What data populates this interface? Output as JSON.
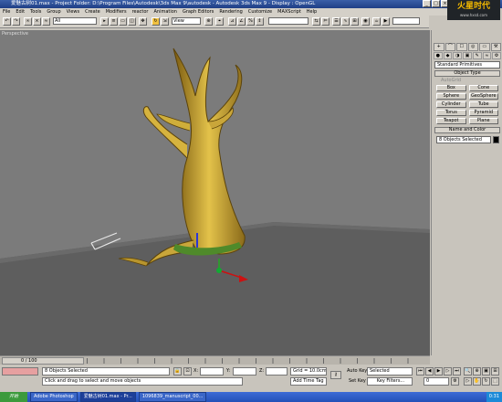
{
  "window": {
    "title": "爱魅古树01.max - Project Folder: D:\\Program Files\\Autodesk\\3ds Max 9\\autodesk - Autodesk 3ds Max 9 - Display : OpenGL",
    "watermark": "火星时代",
    "watermark_url": "www.hxsd.com"
  },
  "menu": [
    "File",
    "Edit",
    "Tools",
    "Group",
    "Views",
    "Create",
    "Modifiers",
    "reactor",
    "Animation",
    "Graph Editors",
    "Rendering",
    "Customize",
    "MAXScript",
    "Help"
  ],
  "toolbar": {
    "selection_filter": "All",
    "ref_coord": "View"
  },
  "viewport": {
    "label": "Perspective"
  },
  "command_panel": {
    "tabs": [
      "+",
      "⌒",
      "☐",
      "◎",
      "▭",
      "⚒"
    ],
    "category_icons": [
      "●",
      "◆",
      "◑",
      "▣",
      "✎",
      "≈",
      "⚙"
    ],
    "primitive_type": "Standard Primitives",
    "object_type_title": "Object Type",
    "autogrid": "AutoGrid",
    "buttons": [
      "Box",
      "Cone",
      "Sphere",
      "GeoSphere",
      "Cylinder",
      "Tube",
      "Torus",
      "Pyramid",
      "Teapot",
      "Plane"
    ],
    "name_color_title": "Name and Color",
    "name_field": "8 Objects Selected",
    "color": "#000000"
  },
  "timeline": {
    "frame": "0 / 100"
  },
  "status": {
    "objects_selected": "8 Objects Selected",
    "prompt": "Click and drag to select and move objects",
    "x_label": "X:",
    "y_label": "Y:",
    "z_label": "Z:",
    "grid": "Grid = 10.0cm",
    "add_time_tag": "Add Time Tag",
    "auto_key": "Auto Key",
    "set_key": "Set Key",
    "key_mode": "Selected",
    "key_filters": "Key Filters...",
    "current_frame": "0"
  },
  "taskbar": {
    "start": "开始",
    "tasks": [
      "Adobe Photoshop",
      "爱魅古树01.max - Pr...",
      "1096839_manuscript_00..."
    ],
    "clock": "0:31"
  }
}
